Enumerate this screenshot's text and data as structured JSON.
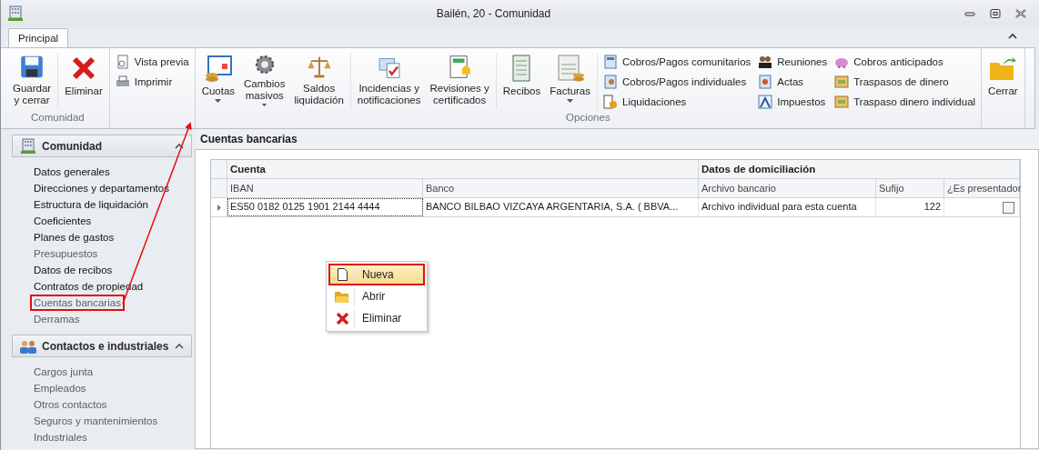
{
  "window": {
    "title": "Bailén, 20 - Comunidad"
  },
  "tabs": [
    {
      "label": "Principal",
      "selected": true
    }
  ],
  "ribbon": [
    {
      "label": "Comunidad",
      "sections": [
        {
          "kind": "large",
          "buttons": [
            {
              "label": "Guardar\ny cerrar",
              "dropdown": false
            }
          ]
        },
        {
          "kind": "large",
          "buttons": [
            {
              "label": "Eliminar",
              "dropdown": false
            }
          ]
        }
      ]
    },
    {
      "sections": [
        {
          "kind": "small",
          "buttons": [
            {
              "label": "Vista previa"
            },
            {
              "label": "Imprimir"
            }
          ]
        }
      ]
    },
    {
      "label": "Opciones",
      "sections": [
        {
          "kind": "large",
          "buttons": [
            {
              "label": "Cuotas",
              "dropdown": true
            },
            {
              "label": "Cambios\nmasivos",
              "dropdown": true
            },
            {
              "label": "Saldos\nliquidación",
              "dropdown": false
            }
          ]
        },
        {
          "kind": "large",
          "buttons": [
            {
              "label": "Incidencias y\nnotificaciones",
              "dropdown": false
            },
            {
              "label": "Revisiones y\ncertificados",
              "dropdown": false
            }
          ]
        },
        {
          "kind": "large",
          "buttons": [
            {
              "label": "Recibos",
              "dropdown": false
            },
            {
              "label": "Facturas",
              "dropdown": true
            }
          ]
        },
        {
          "kind": "small",
          "buttons": [
            {
              "label": "Cobros/Pagos comunitarios"
            },
            {
              "label": "Cobros/Pagos individuales"
            },
            {
              "label": "Liquidaciones"
            }
          ]
        },
        {
          "kind": "small",
          "buttons": [
            {
              "label": "Reuniones"
            },
            {
              "label": "Actas"
            },
            {
              "label": "Impuestos"
            }
          ]
        },
        {
          "kind": "small",
          "buttons": [
            {
              "label": "Cobros anticipados"
            },
            {
              "label": "Traspasos de dinero"
            },
            {
              "label": "Traspaso dinero individual"
            }
          ]
        }
      ]
    },
    {
      "sections": [
        {
          "kind": "large",
          "buttons": [
            {
              "label": "Cerrar",
              "dropdown": false
            }
          ]
        }
      ]
    }
  ],
  "sidebar": [
    {
      "title": "Comunidad",
      "expanded": true,
      "items": [
        {
          "label": "Datos generales",
          "dimmed": false,
          "highlighted": false
        },
        {
          "label": "Direcciones y departamentos",
          "dimmed": false,
          "highlighted": false
        },
        {
          "label": "Estructura de liquidación",
          "dimmed": false,
          "highlighted": false
        },
        {
          "label": "Coeficientes",
          "dimmed": false,
          "highlighted": false
        },
        {
          "label": "Planes de gastos",
          "dimmed": false,
          "highlighted": false
        },
        {
          "label": "Presupuestos",
          "dimmed": true,
          "highlighted": false
        },
        {
          "label": "Datos de recibos",
          "dimmed": false,
          "highlighted": false
        },
        {
          "label": "Contratos de propiedad",
          "dimmed": false,
          "highlighted": false
        },
        {
          "label": "Cuentas bancarias",
          "dimmed": true,
          "highlighted": true
        },
        {
          "label": "Derramas",
          "dimmed": true,
          "highlighted": false
        }
      ]
    },
    {
      "title": "Contactos e industriales",
      "expanded": true,
      "items": [
        {
          "label": "Cargos junta",
          "dimmed": true,
          "highlighted": false
        },
        {
          "label": "Empleados",
          "dimmed": true,
          "highlighted": false
        },
        {
          "label": "Otros contactos",
          "dimmed": true,
          "highlighted": false
        },
        {
          "label": "Seguros y mantenimientos",
          "dimmed": true,
          "highlighted": false
        },
        {
          "label": "Industriales",
          "dimmed": true,
          "highlighted": false
        }
      ]
    }
  ],
  "panel": {
    "title": "Cuentas bancarias",
    "table": {
      "bands": [
        {
          "label": "Cuenta"
        },
        {
          "label": "Datos de domiciliación"
        }
      ],
      "columns": [
        "IBAN",
        "Banco",
        "Archivo bancario",
        "Sufijo",
        "¿Es presentador"
      ],
      "rows": [
        {
          "cells": [
            "ES50 0182 0125 1901 2144 4444",
            "BANCO BILBAO VIZCAYA ARGENTARIA, S.A. ( BBVA...",
            "Archivo individual para esta cuenta",
            "122"
          ],
          "presentador": false,
          "current": true
        }
      ]
    }
  },
  "context_menu": {
    "items": [
      {
        "label": "Nueva",
        "selected": true,
        "highlighted": true
      },
      {
        "label": "Abrir",
        "selected": false,
        "highlighted": false
      },
      {
        "label": "Eliminar",
        "selected": false,
        "highlighted": false
      }
    ]
  }
}
